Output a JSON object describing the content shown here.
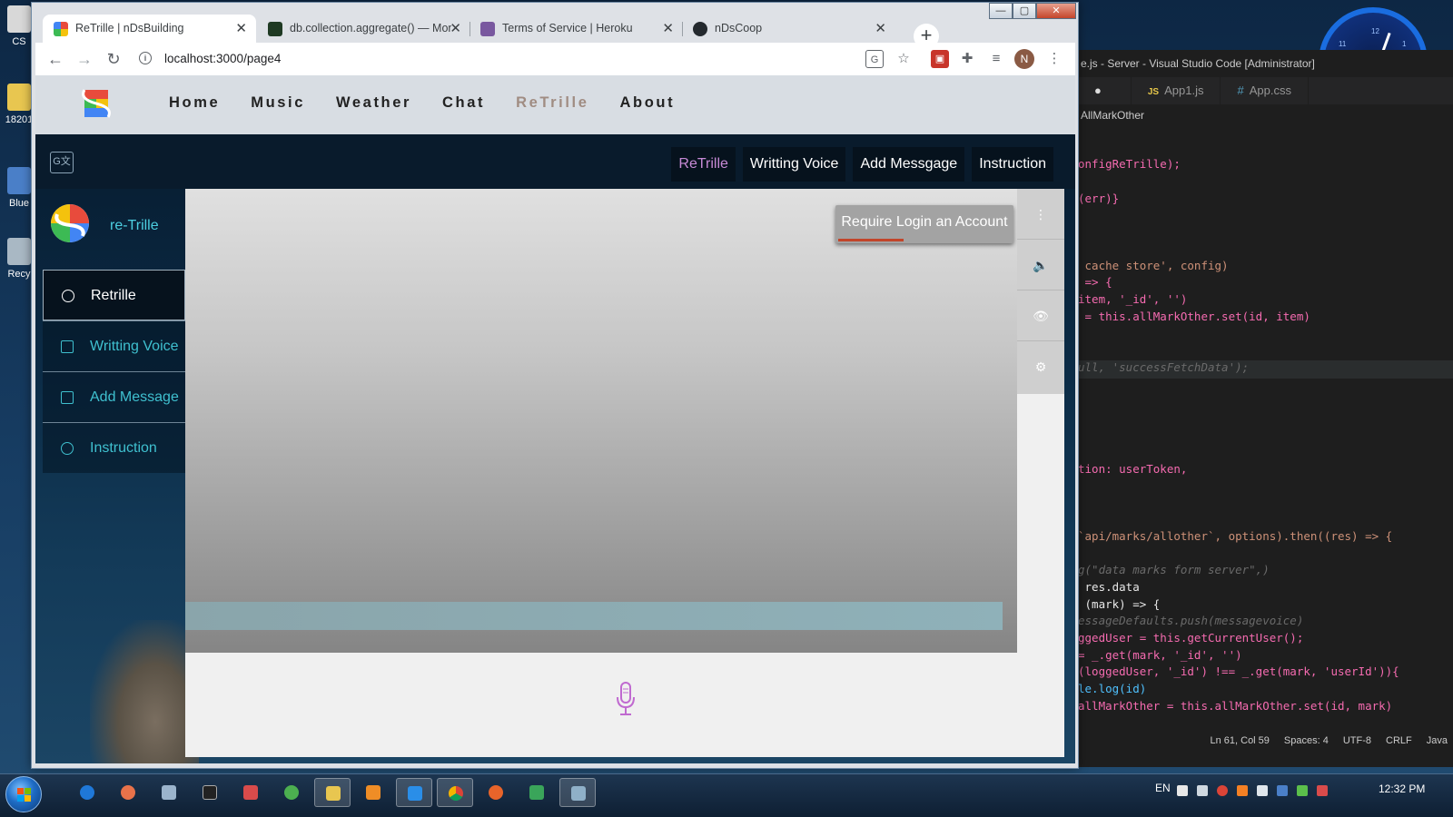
{
  "desktop": {
    "icons": [
      {
        "label": "CS"
      },
      {
        "label": "18201"
      },
      {
        "label": "Blue"
      },
      {
        "label": "Recy"
      }
    ]
  },
  "vscode": {
    "title": "e.js - Server - Visual Studio Code [Administrator]",
    "tabs": [
      {
        "label": "App1.js",
        "kind": "JS"
      },
      {
        "label": "App.css",
        "kind": "#"
      }
    ],
    "breadcrumb": "AllMarkOther",
    "code_lines": [
      "onfigReTrille);",
      "(err)}",
      " cache store', config)",
      " => {",
      "item, '_id', '')",
      " = this.allMarkOther.set(id, item)",
      "ull, 'successFetchData');",
      "tion: userToken,",
      "`api/marks/allother`, options).then((res) => {",
      "g(\"data marks form server\",)",
      " res.data",
      " (mark) => {",
      "essageDefaults.push(messagevoice)",
      "ggedUser = this.getCurrentUser();",
      "= _.get(mark, '_id', '')",
      "(loggedUser, '_id') !== _.get(mark, 'userId')){",
      "le.log(id)",
      "allMarkOther = this.allMarkOther.set(id, mark)"
    ],
    "status": [
      "Ln 61, Col 59",
      "Spaces: 4",
      "UTF-8",
      "CRLF",
      "Java"
    ]
  },
  "browser": {
    "tabs": [
      {
        "label": "ReTrille | nDsBuilding",
        "active": true
      },
      {
        "label": "db.collection.aggregate() — Mon",
        "active": false
      },
      {
        "label": "Terms of Service | Heroku",
        "active": false
      },
      {
        "label": "nDsCoop",
        "active": false
      }
    ],
    "new_tab": "+",
    "window_controls": {
      "minimize": "—",
      "maximize": "▢",
      "close": "✕"
    },
    "url": "localhost:3000/page4",
    "profile_initial": "N"
  },
  "site": {
    "nav": [
      {
        "label": "Home",
        "current": false
      },
      {
        "label": "Music",
        "current": false
      },
      {
        "label": "Weather",
        "current": false
      },
      {
        "label": "Chat",
        "current": false
      },
      {
        "label": "ReTrille",
        "current": true
      },
      {
        "label": "About",
        "current": false
      }
    ]
  },
  "app": {
    "translate_icon": "G文",
    "subnav": [
      {
        "label": "ReTrille",
        "current": true
      },
      {
        "label": "Writting Voice",
        "current": false
      },
      {
        "label": "Add Messgage",
        "current": false
      },
      {
        "label": "Instruction",
        "current": false
      }
    ],
    "brand": "re-Trille",
    "sidebar": [
      {
        "label": "Retrille",
        "current": true,
        "icon": "retrille-icon"
      },
      {
        "label": "Writting Voice",
        "current": false,
        "icon": "document-icon"
      },
      {
        "label": "Add Message",
        "current": false,
        "icon": "add-message-icon"
      },
      {
        "label": "Instruction",
        "current": false,
        "icon": "help-icon"
      }
    ],
    "login_notice": "Require Login an Account",
    "tools": [
      {
        "icon": "more-vertical-icon",
        "glyph": "⋮"
      },
      {
        "icon": "volume-icon",
        "glyph": "🔈"
      },
      {
        "icon": "eye-icon",
        "glyph": "👁"
      },
      {
        "icon": "settings-icon",
        "glyph": "⚙"
      }
    ],
    "colors": {
      "accent_text": "#4ccfe0",
      "current_subnav": "#c78ad6",
      "mic": "#c06ad0",
      "notice_bar": "#c2452a"
    }
  },
  "taskbar": {
    "lang": "EN",
    "time": "12:32 PM"
  }
}
